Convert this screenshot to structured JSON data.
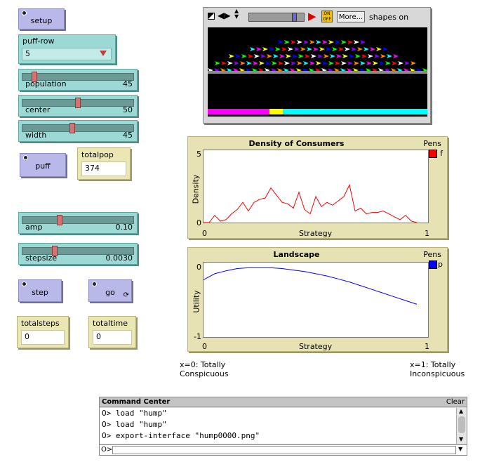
{
  "buttons": {
    "setup": "setup",
    "puff": "puff",
    "step": "step",
    "go": "go"
  },
  "chooser": {
    "label": "puff-row",
    "value": "5"
  },
  "sliders": {
    "population": {
      "label": "population",
      "value": "45",
      "fraction": 0.09
    },
    "center": {
      "label": "center",
      "value": "50",
      "fraction": 0.5
    },
    "width": {
      "label": "width",
      "value": "45",
      "fraction": 0.45
    },
    "amp": {
      "label": "amp",
      "value": "0.10",
      "fraction": 0.33
    },
    "stepsize": {
      "label": "stepsize",
      "value": "0.0030",
      "fraction": 0.28
    }
  },
  "monitors": {
    "totalpop": {
      "label": "totalpop",
      "value": "374"
    },
    "totalsteps": {
      "label": "totalsteps",
      "value": "0"
    },
    "totaltime": {
      "label": "totaltime",
      "value": "0"
    }
  },
  "view_toolbar": {
    "more_label": "More...",
    "shapes_label": "shapes on",
    "speed_fraction": 0.85
  },
  "colors": {
    "magenta": "#ff00ff",
    "yellow": "#ffff00",
    "cyan": "#00ffff",
    "density_pen": "#ff0000",
    "landscape_pen": "#0000ff"
  },
  "plots": {
    "density": {
      "title": "Density of Consumers",
      "pens_label": "Pens",
      "pen_name": "f",
      "ylabel": "Density",
      "xlabel": "Strategy",
      "ymax_label": "5",
      "ymin_label": "0",
      "xmin_label": "0",
      "xmax_label": "1"
    },
    "landscape": {
      "title": "Landscape",
      "pens_label": "Pens",
      "pen_name": "p",
      "ylabel": "Utility",
      "xlabel": "Strategy",
      "ymax_label": "0",
      "ymin_label": "-1",
      "xmin_label": "0",
      "xmax_label": "1"
    }
  },
  "chart_data": [
    {
      "type": "line",
      "title": "Density of Consumers",
      "xlabel": "Strategy",
      "ylabel": "Density",
      "xlim": [
        0,
        1
      ],
      "ylim": [
        0,
        5
      ],
      "series": [
        {
          "name": "f",
          "x": [
            0.0,
            0.025,
            0.05,
            0.075,
            0.1,
            0.125,
            0.15,
            0.175,
            0.2,
            0.225,
            0.25,
            0.275,
            0.3,
            0.325,
            0.35,
            0.375,
            0.4,
            0.425,
            0.45,
            0.475,
            0.5,
            0.525,
            0.55,
            0.575,
            0.6,
            0.625,
            0.65,
            0.675,
            0.7,
            0.725,
            0.75,
            0.775,
            0.8,
            0.825,
            0.85,
            0.875,
            0.9,
            0.925,
            0.95
          ],
          "y": [
            0.0,
            0.0,
            0.5,
            0.1,
            0.2,
            0.6,
            0.9,
            1.4,
            0.8,
            1.4,
            1.6,
            1.7,
            2.4,
            1.9,
            1.4,
            1.3,
            1.0,
            2.1,
            0.9,
            0.6,
            1.8,
            1.1,
            1.4,
            1.2,
            1.5,
            1.8,
            2.6,
            0.8,
            1.0,
            0.6,
            0.7,
            0.7,
            0.8,
            0.6,
            0.4,
            0.2,
            0.5,
            0.1,
            0.0
          ]
        }
      ]
    },
    {
      "type": "line",
      "title": "Landscape",
      "xlabel": "Strategy",
      "ylabel": "Utility",
      "xlim": [
        0,
        1
      ],
      "ylim": [
        -1,
        0
      ],
      "series": [
        {
          "name": "p",
          "x": [
            0.0,
            0.05,
            0.1,
            0.15,
            0.2,
            0.25,
            0.3,
            0.35,
            0.4,
            0.45,
            0.5,
            0.55,
            0.6,
            0.65,
            0.7,
            0.75,
            0.8,
            0.85,
            0.9,
            0.95
          ],
          "y": [
            -0.23,
            -0.15,
            -0.11,
            -0.08,
            -0.07,
            -0.07,
            -0.07,
            -0.08,
            -0.1,
            -0.12,
            -0.15,
            -0.18,
            -0.22,
            -0.26,
            -0.31,
            -0.36,
            -0.41,
            -0.46,
            -0.51,
            -0.56
          ]
        }
      ]
    }
  ],
  "captions": {
    "left": "x=0: Totally Conspicuous",
    "right": "x=1: Totally Inconspicuous"
  },
  "command_center": {
    "title": "Command Center",
    "clear": "Clear",
    "lines": [
      "O>  load \"hump\"",
      "O>  load \"hump\"",
      "O> export-interface \"hump0000.png\""
    ],
    "prompt": "O>"
  }
}
